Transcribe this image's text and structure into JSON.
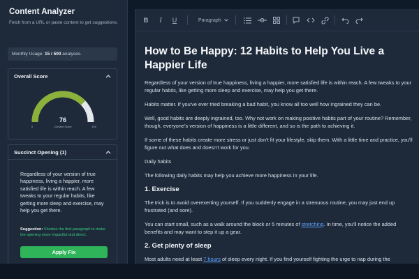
{
  "sidebar": {
    "title": "Content Analyzer",
    "subtitle": "Fetch from a URL or paste content to get suggestions.",
    "usage_label": "Monthly Usage:",
    "usage_value": "15 / 500",
    "usage_suffix": "analyses.",
    "overall": {
      "title": "Overall Score",
      "score": "76",
      "score_fraction": 0.76,
      "score_label": "Content Score",
      "min_label": "0",
      "max_label": "100",
      "colors": {
        "fill": "#8bb13b",
        "track": "#e4e7eb"
      }
    },
    "opening": {
      "title": "Succinct Opening (1)",
      "text": "Regardless of your version of true happiness, living a happier, more satisfied life is within reach. A few tweaks to your regular habits, like getting more sleep and exercise, may help you get there.",
      "suggestion_label": "Suggestion:",
      "suggestion_text": "Shorten the first paragraph to make the opening more impactful and direct.",
      "button": "Apply Fix"
    }
  },
  "toolbar": {
    "bold": "B",
    "italic": "I",
    "underline": "U",
    "format": "Paragraph",
    "icons": [
      "list-icon",
      "divider-icon",
      "grid-icon",
      "comment-icon",
      "code-icon",
      "link-icon",
      "undo-icon",
      "redo-icon"
    ]
  },
  "document": {
    "title": "How to Be Happy: 12 Habits to Help You Live a Happier Life",
    "p1": "Regardless of your version of true happiness, living a happier, more satisfied life is within reach. A few tweaks to your regular habits, like getting more sleep and exercise, may help you get there.",
    "p2": "Habits matter. If you've ever tried breaking a bad habit, you know all too well how ingrained they can be.",
    "p3": "Well, good habits are deeply ingrained, too. Why not work on making positive habits part of your routine? Remember, though, everyone's version of happiness is a little different, and so is the path to achieving it.",
    "p4": "If some of these habits create more stress or just don't fit your lifestyle, skip them. With a little time and practice, you'll figure out what does and doesn't work for you.",
    "p5": "Daily habits",
    "p6": "The following daily habits may help you achieve more happiness in your life.",
    "h1": "1. Exercise",
    "p7": "The trick is to avoid overexerting yourself. If you suddenly engage in a strenuous routine, you may just end up frustrated (and sore).",
    "p8_a": "You can start small, such as a walk around the block or 5 minutes of ",
    "p8_link": "stretching",
    "p8_b": ". In time, you'll notice the added benefits and may want to step it up a gear.",
    "h2": "2. Get plenty of sleep",
    "p9_a": "Most adults need at least ",
    "p9_link": "7 hours",
    "p9_b": " of sleep every night. If you find yourself fighting the urge to nap during the"
  }
}
